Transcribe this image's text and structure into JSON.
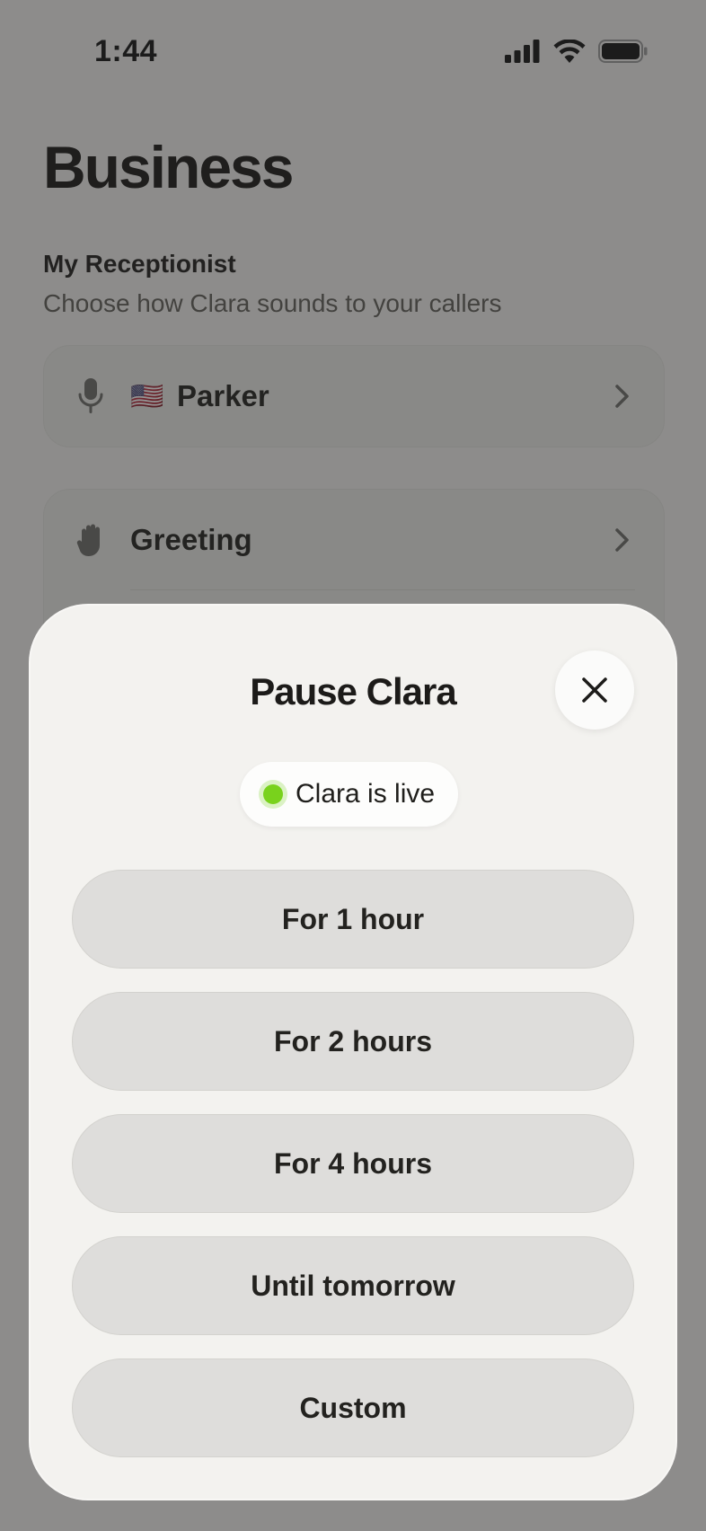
{
  "status_bar": {
    "time": "1:44",
    "icons": [
      "cellular-signal-icon",
      "wifi-icon",
      "battery-icon"
    ]
  },
  "page": {
    "title": "Business",
    "section_title": "My Receptionist",
    "section_subtitle": "Choose how Clara sounds to your callers"
  },
  "voice_row": {
    "icon": "microphone-icon",
    "flag": "🇺🇸",
    "label": "Parker"
  },
  "settings_rows": [
    {
      "icon": "hand-icon",
      "label": "Greeting"
    }
  ],
  "sheet": {
    "title": "Pause Clara",
    "status_label": "Clara is live",
    "status_color": "#79d21c",
    "options": [
      {
        "label": "For 1 hour"
      },
      {
        "label": "For 2 hours"
      },
      {
        "label": "For 4 hours"
      },
      {
        "label": "Until tomorrow"
      },
      {
        "label": "Custom"
      }
    ]
  }
}
